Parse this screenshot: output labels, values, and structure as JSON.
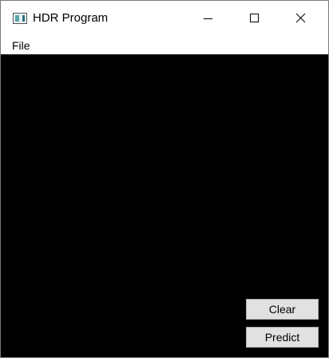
{
  "window": {
    "title": "HDR Program",
    "controls": {
      "minimize_icon": "minimize-icon",
      "maximize_icon": "maximize-icon",
      "close_icon": "close-icon"
    }
  },
  "menubar": {
    "items": [
      {
        "label": "File"
      }
    ]
  },
  "canvas": {
    "background": "#000000"
  },
  "actions": {
    "clear_label": "Clear",
    "predict_label": "Predict"
  }
}
